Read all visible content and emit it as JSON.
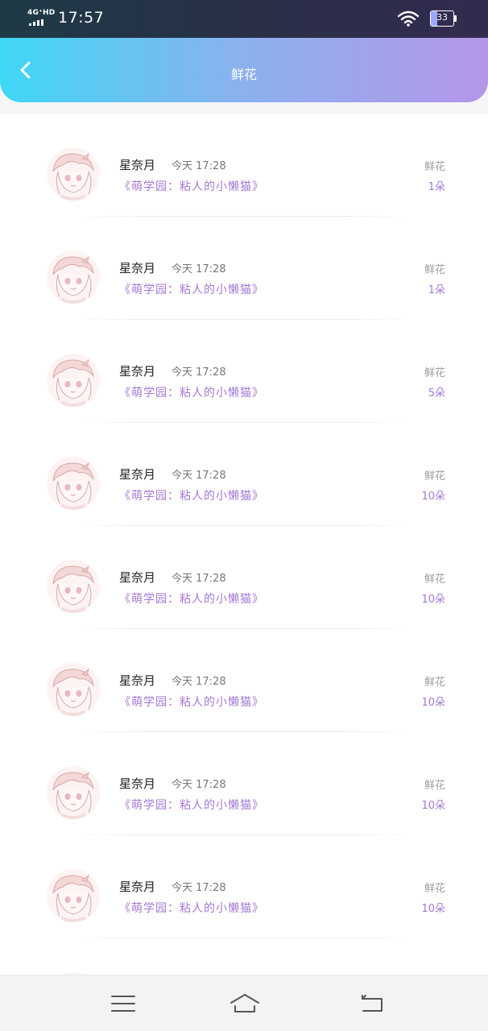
{
  "status_bar": {
    "network": "4G⁺HD",
    "time": "17:57",
    "battery": "33",
    "icons": [
      "signal-icon",
      "wifi-icon",
      "battery-icon"
    ]
  },
  "header": {
    "title": "鲜花",
    "back_icon": "back-chevron-icon"
  },
  "items": [
    {
      "name": "星奈月",
      "time": "今天 17:28",
      "book": "《萌学园：粘人的小懒猫》",
      "gift_label": "鲜花",
      "gift_count": "1朵"
    },
    {
      "name": "星奈月",
      "time": "今天 17:28",
      "book": "《萌学园：粘人的小懒猫》",
      "gift_label": "鲜花",
      "gift_count": "1朵"
    },
    {
      "name": "星奈月",
      "time": "今天 17:28",
      "book": "《萌学园：粘人的小懒猫》",
      "gift_label": "鲜花",
      "gift_count": "5朵"
    },
    {
      "name": "星奈月",
      "time": "今天 17:28",
      "book": "《萌学园：粘人的小懒猫》",
      "gift_label": "鲜花",
      "gift_count": "10朵"
    },
    {
      "name": "星奈月",
      "time": "今天 17:28",
      "book": "《萌学园：粘人的小懒猫》",
      "gift_label": "鲜花",
      "gift_count": "10朵"
    },
    {
      "name": "星奈月",
      "time": "今天 17:28",
      "book": "《萌学园：粘人的小懒猫》",
      "gift_label": "鲜花",
      "gift_count": "10朵"
    },
    {
      "name": "星奈月",
      "time": "今天 17:28",
      "book": "《萌学园：粘人的小懒猫》",
      "gift_label": "鲜花",
      "gift_count": "10朵"
    },
    {
      "name": "星奈月",
      "time": "今天 17:28",
      "book": "《萌学园：粘人的小懒猫》",
      "gift_label": "鲜花",
      "gift_count": "10朵"
    }
  ],
  "nav_bar": {
    "icons": [
      "menu-icon",
      "home-icon",
      "back-icon"
    ]
  },
  "colors": {
    "header_gradient": [
      "#3fd7f6",
      "#8bb1ee",
      "#b596e8"
    ],
    "accent_purple": "#a478d6",
    "status_bar_bg": "#2a2f48"
  }
}
